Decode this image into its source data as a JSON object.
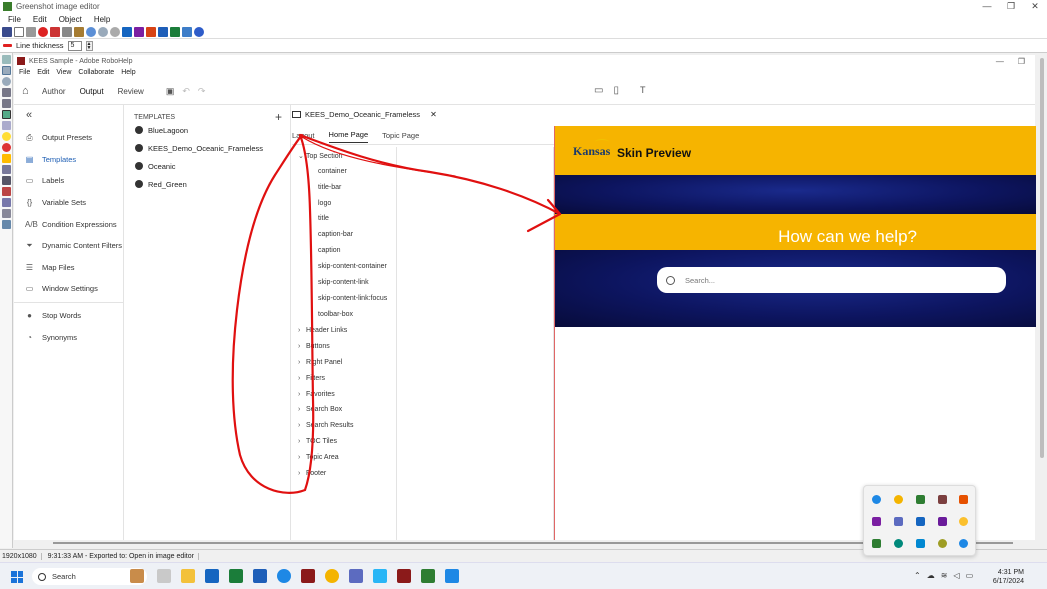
{
  "greenshot": {
    "title": "Greenshot image editor",
    "window_buttons": [
      "—",
      "❐",
      "✕"
    ],
    "menu": [
      "File",
      "Edit",
      "Object",
      "Help"
    ],
    "line_thickness_label": "Line thickness",
    "line_thickness_value": "5",
    "status": {
      "resolution": "1920x1080",
      "message": "9:31:33 AM - Exported to: Open in image editor"
    }
  },
  "robohelp": {
    "title": "KEES Sample - Adobe RoboHelp",
    "menu": [
      "File",
      "Edit",
      "View",
      "Collaborate",
      "Help"
    ],
    "modes": [
      "Author",
      "Output",
      "Review"
    ],
    "active_mode": "Output",
    "sidebar": {
      "collapse_glyph": "«",
      "items": [
        {
          "label": "Output Presets",
          "icon": "⎙"
        },
        {
          "label": "Templates",
          "icon": "▤",
          "active": true
        },
        {
          "label": "Labels",
          "icon": "▭"
        },
        {
          "label": "Variable Sets",
          "icon": "{}"
        },
        {
          "label": "Condition Expressions",
          "icon": "A/B"
        },
        {
          "label": "Dynamic Content Filters",
          "icon": "⏷"
        },
        {
          "label": "Map Files",
          "icon": "☰"
        },
        {
          "label": "Window Settings",
          "icon": "▭"
        },
        {
          "label": "Stop Words",
          "icon": "●"
        },
        {
          "label": "Synonyms",
          "icon": "◔"
        }
      ]
    },
    "templates": {
      "header": "TEMPLATES",
      "add_glyph": "+",
      "items": [
        "BlueLagoon",
        "KEES_Demo_Oceanic_Frameless",
        "Oceanic",
        "Red_Green"
      ]
    },
    "editor": {
      "doc_tab": "KEES_Demo_Oceanic_Frameless",
      "close_glyph": "✕",
      "subtabs": [
        "Layout",
        "Home Page",
        "Topic Page"
      ],
      "active_subtab": "Home Page",
      "tree": {
        "expanded_group": "Top Section",
        "children": [
          "container",
          "title-bar",
          "logo",
          "title",
          "caption-bar",
          "caption",
          "skip-content-container",
          "skip-content-link",
          "skip-content-link:focus",
          "toolbar-box"
        ],
        "groups": [
          "Header Links",
          "Buttons",
          "Right Panel",
          "Filters",
          "Favorites",
          "Search Box",
          "Search Results",
          "TOC Tiles",
          "Topic Area",
          "Footer"
        ]
      }
    },
    "preview": {
      "logo_text": "Kansas",
      "title": "Skin Preview",
      "headline": "How can we help?",
      "search_placeholder": "Search...",
      "colors": {
        "gold": "#f6b400",
        "navy": "#0d1560"
      }
    }
  },
  "taskbar": {
    "search_label": "Search",
    "time": "4:31 PM",
    "date": "6/17/2024",
    "tray_chevron": "⌃"
  },
  "annotation": {
    "color": "#e01010",
    "shape": "hand-drawn loop with arrow pointing to preview"
  }
}
